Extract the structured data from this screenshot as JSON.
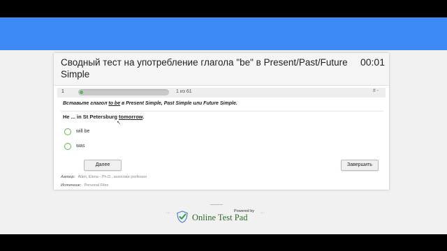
{
  "quiz": {
    "title": "Сводный тест на употребление глагола \"be\" в Present/Past/Future Simple",
    "timer": "00:01",
    "question_number": "1",
    "progress_fraction": 0.02,
    "progress_count": "1 из 61",
    "hash_label": "# -",
    "instruction": {
      "part1": "Вставьте глагол ",
      "verb": "to be",
      "part2": " в Present Simple, Past Simple или Future Simple."
    },
    "question": {
      "part1": "He ... in St Petersburg ",
      "word": "tomorrow",
      "part2": "."
    },
    "options": [
      "will be",
      "was"
    ],
    "next_button": "Далее",
    "finish_button": "Завершить",
    "author_label": "Автор:",
    "author_value": "Allen, Elena - Ph.D., associate professor",
    "sources_label": "Источник:",
    "sources_value": "Personal Files"
  },
  "footer": {
    "powered_by": "Powered by",
    "brand": "Online Test Pad",
    "left_dots": "···",
    "right_dots": "···"
  },
  "colors": {
    "header_blue": "#3d8af7",
    "progress_green": "#5cb85c",
    "radio_green": "#6ab04c",
    "brand_green": "#2d6a2d"
  },
  "icons": {
    "logo": "check-shield-icon",
    "cursor": "mouse-pointer-icon",
    "radio": "radio-circle-icon"
  }
}
